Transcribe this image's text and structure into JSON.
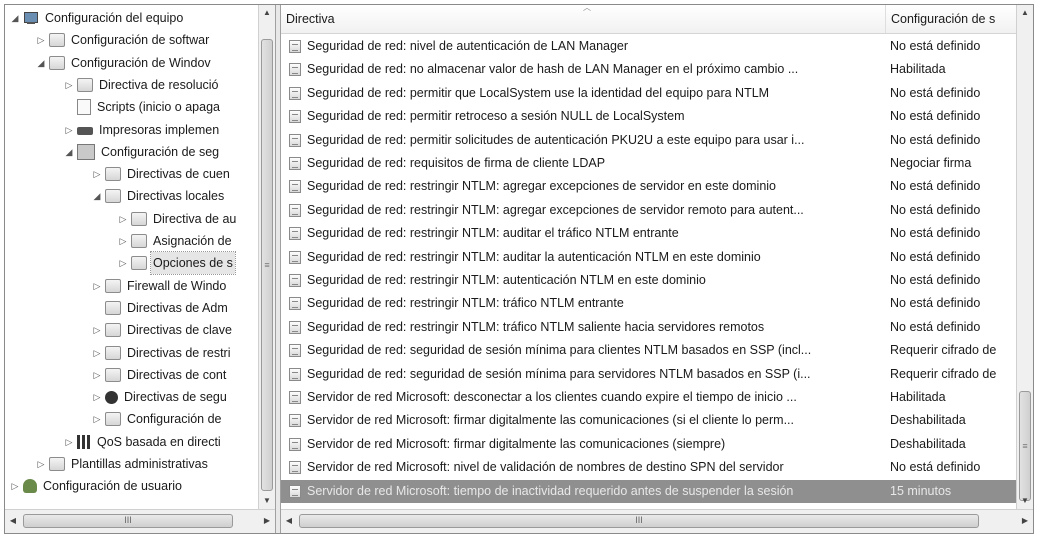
{
  "tree": {
    "items": [
      {
        "label": "Configuración del equipo",
        "expander": "◢",
        "icon": "computer-icon"
      },
      {
        "label": "Configuración de softwar",
        "expander": "▷",
        "icon": "folder-icon"
      },
      {
        "label": "Configuración de Windov",
        "expander": "◢",
        "icon": "folder-icon"
      },
      {
        "label": "Directiva de resolució",
        "expander": "▷",
        "icon": "folder-icon"
      },
      {
        "label": "Scripts (inicio o apaga",
        "expander": "",
        "icon": "script-icon"
      },
      {
        "label": "Impresoras implemen",
        "expander": "▷",
        "icon": "printer-icon"
      },
      {
        "label": "Configuración de seg",
        "expander": "◢",
        "icon": "security-settings-icon"
      },
      {
        "label": "Directivas de cuen",
        "expander": "▷",
        "icon": "folder-icon"
      },
      {
        "label": "Directivas locales",
        "expander": "◢",
        "icon": "folder-icon"
      },
      {
        "label": "Directiva de au",
        "expander": "▷",
        "icon": "folder-icon"
      },
      {
        "label": "Asignación de",
        "expander": "▷",
        "icon": "folder-icon"
      },
      {
        "label": "Opciones de s",
        "expander": "▷",
        "icon": "folder-icon"
      },
      {
        "label": "Firewall de Windo",
        "expander": "▷",
        "icon": "folder-icon"
      },
      {
        "label": "Directivas de Adm",
        "expander": "",
        "icon": "folder-icon"
      },
      {
        "label": "Directivas de clave",
        "expander": "▷",
        "icon": "folder-icon"
      },
      {
        "label": "Directivas de restri",
        "expander": "▷",
        "icon": "folder-icon"
      },
      {
        "label": "Directivas de cont",
        "expander": "▷",
        "icon": "folder-icon"
      },
      {
        "label": "Directivas de segu",
        "expander": "▷",
        "icon": "security-icon"
      },
      {
        "label": "Configuración de",
        "expander": "▷",
        "icon": "folder-icon"
      },
      {
        "label": "QoS basada en directi",
        "expander": "▷",
        "icon": "qos-bars-icon"
      },
      {
        "label": "Plantillas administrativas",
        "expander": "▷",
        "icon": "folder-icon"
      },
      {
        "label": "Configuración de usuario",
        "expander": "▷",
        "icon": "users-icon"
      }
    ],
    "selected_label": "Opciones de s"
  },
  "list": {
    "header": {
      "directiva": "Directiva",
      "configuracion": "Configuración de s"
    },
    "rows": [
      {
        "directiva": "Seguridad de red: nivel de autenticación de LAN Manager",
        "config": "No está definido"
      },
      {
        "directiva": "Seguridad de red: no almacenar valor de hash de LAN Manager en el próximo cambio ...",
        "config": "Habilitada"
      },
      {
        "directiva": "Seguridad de red: permitir que LocalSystem use la identidad del equipo para NTLM",
        "config": "No está definido"
      },
      {
        "directiva": "Seguridad de red: permitir retroceso a sesión NULL de LocalSystem",
        "config": "No está definido"
      },
      {
        "directiva": "Seguridad de red: permitir solicitudes de autenticación PKU2U a este equipo para usar i...",
        "config": "No está definido"
      },
      {
        "directiva": "Seguridad de red: requisitos de firma de cliente LDAP",
        "config": "Negociar firma"
      },
      {
        "directiva": "Seguridad de red: restringir NTLM: agregar excepciones de servidor en este dominio",
        "config": "No está definido"
      },
      {
        "directiva": "Seguridad de red: restringir NTLM: agregar excepciones de servidor remoto para autent...",
        "config": "No está definido"
      },
      {
        "directiva": "Seguridad de red: restringir NTLM: auditar el tráfico NTLM entrante",
        "config": "No está definido"
      },
      {
        "directiva": "Seguridad de red: restringir NTLM: auditar la autenticación NTLM en este dominio",
        "config": "No está definido"
      },
      {
        "directiva": "Seguridad de red: restringir NTLM: autenticación NTLM en este dominio",
        "config": "No está definido"
      },
      {
        "directiva": "Seguridad de red: restringir NTLM: tráfico NTLM entrante",
        "config": "No está definido"
      },
      {
        "directiva": "Seguridad de red: restringir NTLM: tráfico NTLM saliente hacia servidores remotos",
        "config": "No está definido"
      },
      {
        "directiva": "Seguridad de red: seguridad de sesión mínima para clientes NTLM basados en SSP (incl...",
        "config": "Requerir cifrado de"
      },
      {
        "directiva": "Seguridad de red: seguridad de sesión mínima para servidores NTLM basados en SSP (i...",
        "config": "Requerir cifrado de"
      },
      {
        "directiva": "Servidor de red Microsoft: desconectar a los clientes cuando expire el tiempo de inicio ...",
        "config": "Habilitada"
      },
      {
        "directiva": "Servidor de red Microsoft: firmar digitalmente las comunicaciones (si el cliente lo perm...",
        "config": "Deshabilitada"
      },
      {
        "directiva": "Servidor de red Microsoft: firmar digitalmente las comunicaciones (siempre)",
        "config": "Deshabilitada"
      },
      {
        "directiva": "Servidor de red Microsoft: nivel de validación de nombres de destino SPN del servidor",
        "config": "No está definido"
      },
      {
        "directiva": "Servidor de red Microsoft: tiempo de inactividad requerido antes de suspender la sesión",
        "config": "15 minutos"
      }
    ],
    "selected_index": 19
  },
  "scrollbars": {
    "horizontal_thumb_grip": "III",
    "vertical_thumb_grip": "≡"
  }
}
